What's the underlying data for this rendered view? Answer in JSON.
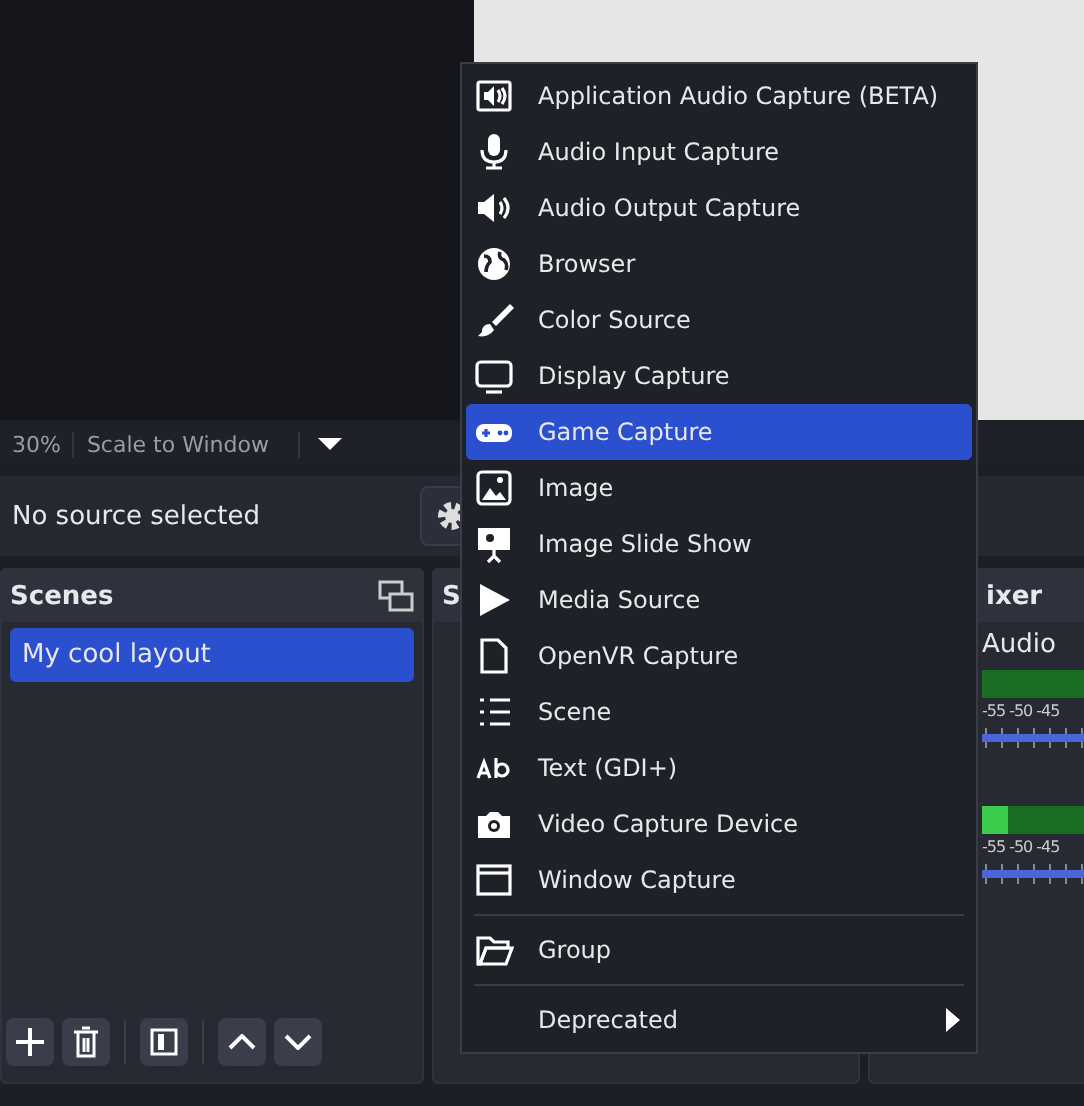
{
  "status_bar": {
    "zoom": "30%",
    "scale_mode": "Scale to Window"
  },
  "context_bar": {
    "text": "No source selected"
  },
  "scenes": {
    "title": "Scenes",
    "items": [
      {
        "label": "My cool layout",
        "selected": true
      }
    ]
  },
  "sources": {
    "title": "S"
  },
  "mixer": {
    "title": "ixer",
    "channels": [
      {
        "name": "Audio",
        "ticks": [
          "-55",
          "-50",
          "-45"
        ]
      },
      {
        "level": 0.25,
        "ticks": [
          "-55",
          "-50",
          "-45"
        ]
      }
    ]
  },
  "menu": {
    "items": [
      {
        "label": "Application Audio Capture (BETA)",
        "selected": false
      },
      {
        "label": "Audio Input Capture",
        "selected": false
      },
      {
        "label": "Audio Output Capture",
        "selected": false
      },
      {
        "label": "Browser",
        "selected": false
      },
      {
        "label": "Color Source",
        "selected": false
      },
      {
        "label": "Display Capture",
        "selected": false
      },
      {
        "label": "Game Capture",
        "selected": true
      },
      {
        "label": "Image",
        "selected": false
      },
      {
        "label": "Image Slide Show",
        "selected": false
      },
      {
        "label": "Media Source",
        "selected": false
      },
      {
        "label": "OpenVR Capture",
        "selected": false
      },
      {
        "label": "Scene",
        "selected": false
      },
      {
        "label": "Text (GDI+)",
        "selected": false
      },
      {
        "label": "Video Capture Device",
        "selected": false
      },
      {
        "label": "Window Capture",
        "selected": false
      },
      {
        "label": "Group",
        "selected": false,
        "separator_before": true
      },
      {
        "label": "Deprecated",
        "selected": false,
        "separator_before": true,
        "submenu": true
      }
    ]
  }
}
